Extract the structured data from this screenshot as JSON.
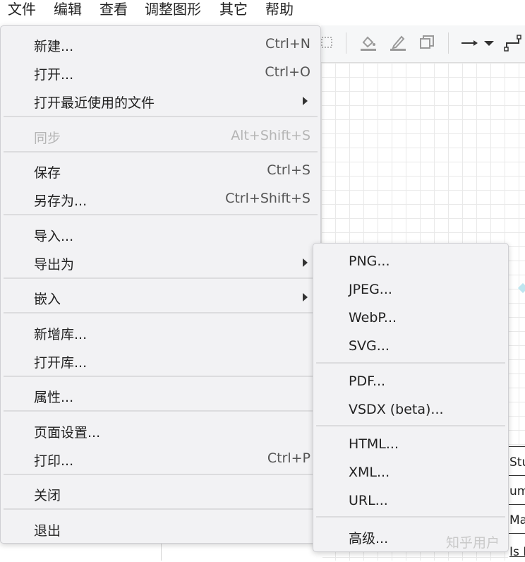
{
  "menubar": {
    "items": [
      "文件",
      "编辑",
      "查看",
      "调整图形",
      "其它",
      "帮助"
    ]
  },
  "file_menu": {
    "items": [
      {
        "label": "新建...",
        "shortcut": "Ctrl+N"
      },
      {
        "label": "打开...",
        "shortcut": "Ctrl+O"
      },
      {
        "label": "打开最近使用的文件",
        "shortcut": ""
      },
      {
        "label": "同步",
        "shortcut": "Alt+Shift+S"
      },
      {
        "label": "保存",
        "shortcut": "Ctrl+S"
      },
      {
        "label": "另存为...",
        "shortcut": "Ctrl+Shift+S"
      },
      {
        "label": "导入...",
        "shortcut": ""
      },
      {
        "label": "导出为",
        "shortcut": ""
      },
      {
        "label": "嵌入",
        "shortcut": ""
      },
      {
        "label": "新增库...",
        "shortcut": ""
      },
      {
        "label": "打开库...",
        "shortcut": ""
      },
      {
        "label": "属性...",
        "shortcut": ""
      },
      {
        "label": "页面设置...",
        "shortcut": ""
      },
      {
        "label": "打印...",
        "shortcut": "Ctrl+P"
      },
      {
        "label": "关闭",
        "shortcut": ""
      },
      {
        "label": "退出",
        "shortcut": ""
      }
    ]
  },
  "export_menu": {
    "items": [
      {
        "label": "PNG..."
      },
      {
        "label": "JPEG..."
      },
      {
        "label": "WebP..."
      },
      {
        "label": "SVG..."
      },
      {
        "label": "PDF..."
      },
      {
        "label": "VSDX (beta)..."
      },
      {
        "label": "HTML..."
      },
      {
        "label": "XML..."
      },
      {
        "label": "URL..."
      },
      {
        "label": "高级..."
      }
    ]
  },
  "canvas": {
    "table_rows": [
      "Stu",
      "um",
      "Mar",
      "Is Eligible To"
    ]
  },
  "watermark": "知乎用户",
  "colors": {
    "menu_bg": "#f2f2f4",
    "disabled": "#b5b5b5",
    "grid": "#e9e9e9"
  },
  "icons": [
    "fill-color-icon",
    "line-color-icon",
    "shadow-icon",
    "arrow-style-icon",
    "dropdown-icon",
    "waypoint-icon",
    "selection-icon"
  ]
}
